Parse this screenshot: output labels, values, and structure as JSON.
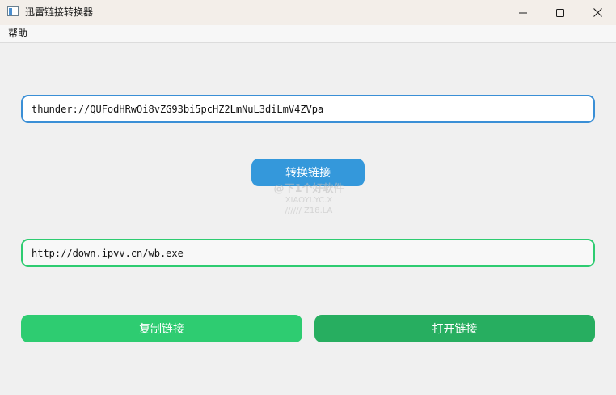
{
  "window": {
    "title": "迅雷链接转换器",
    "controls": {
      "minimize_icon": "minimize-icon",
      "maximize_icon": "maximize-icon",
      "close_icon": "close-icon"
    }
  },
  "menubar": {
    "items": [
      {
        "label": "帮助"
      }
    ]
  },
  "inputs": {
    "thunder_link": {
      "value": "thunder://QUFodHRwOi8vZG93bi5pcHZ2LmNuL3diLmV4ZVpa",
      "border_color": "#3a8fd6"
    },
    "http_link": {
      "value": "http://down.ipvv.cn/wb.exe",
      "border_color": "#2ecc71"
    }
  },
  "buttons": {
    "convert": {
      "label": "转换链接",
      "color": "#3498db"
    },
    "copy": {
      "label": "复制链接",
      "color": "#2ecc71"
    },
    "open": {
      "label": "打开链接",
      "color": "#27ae60"
    }
  },
  "watermark": {
    "line1": "@下1个好软件",
    "line2": "XIAOYI.YC.X",
    "line3": "////// Z18.LA"
  }
}
